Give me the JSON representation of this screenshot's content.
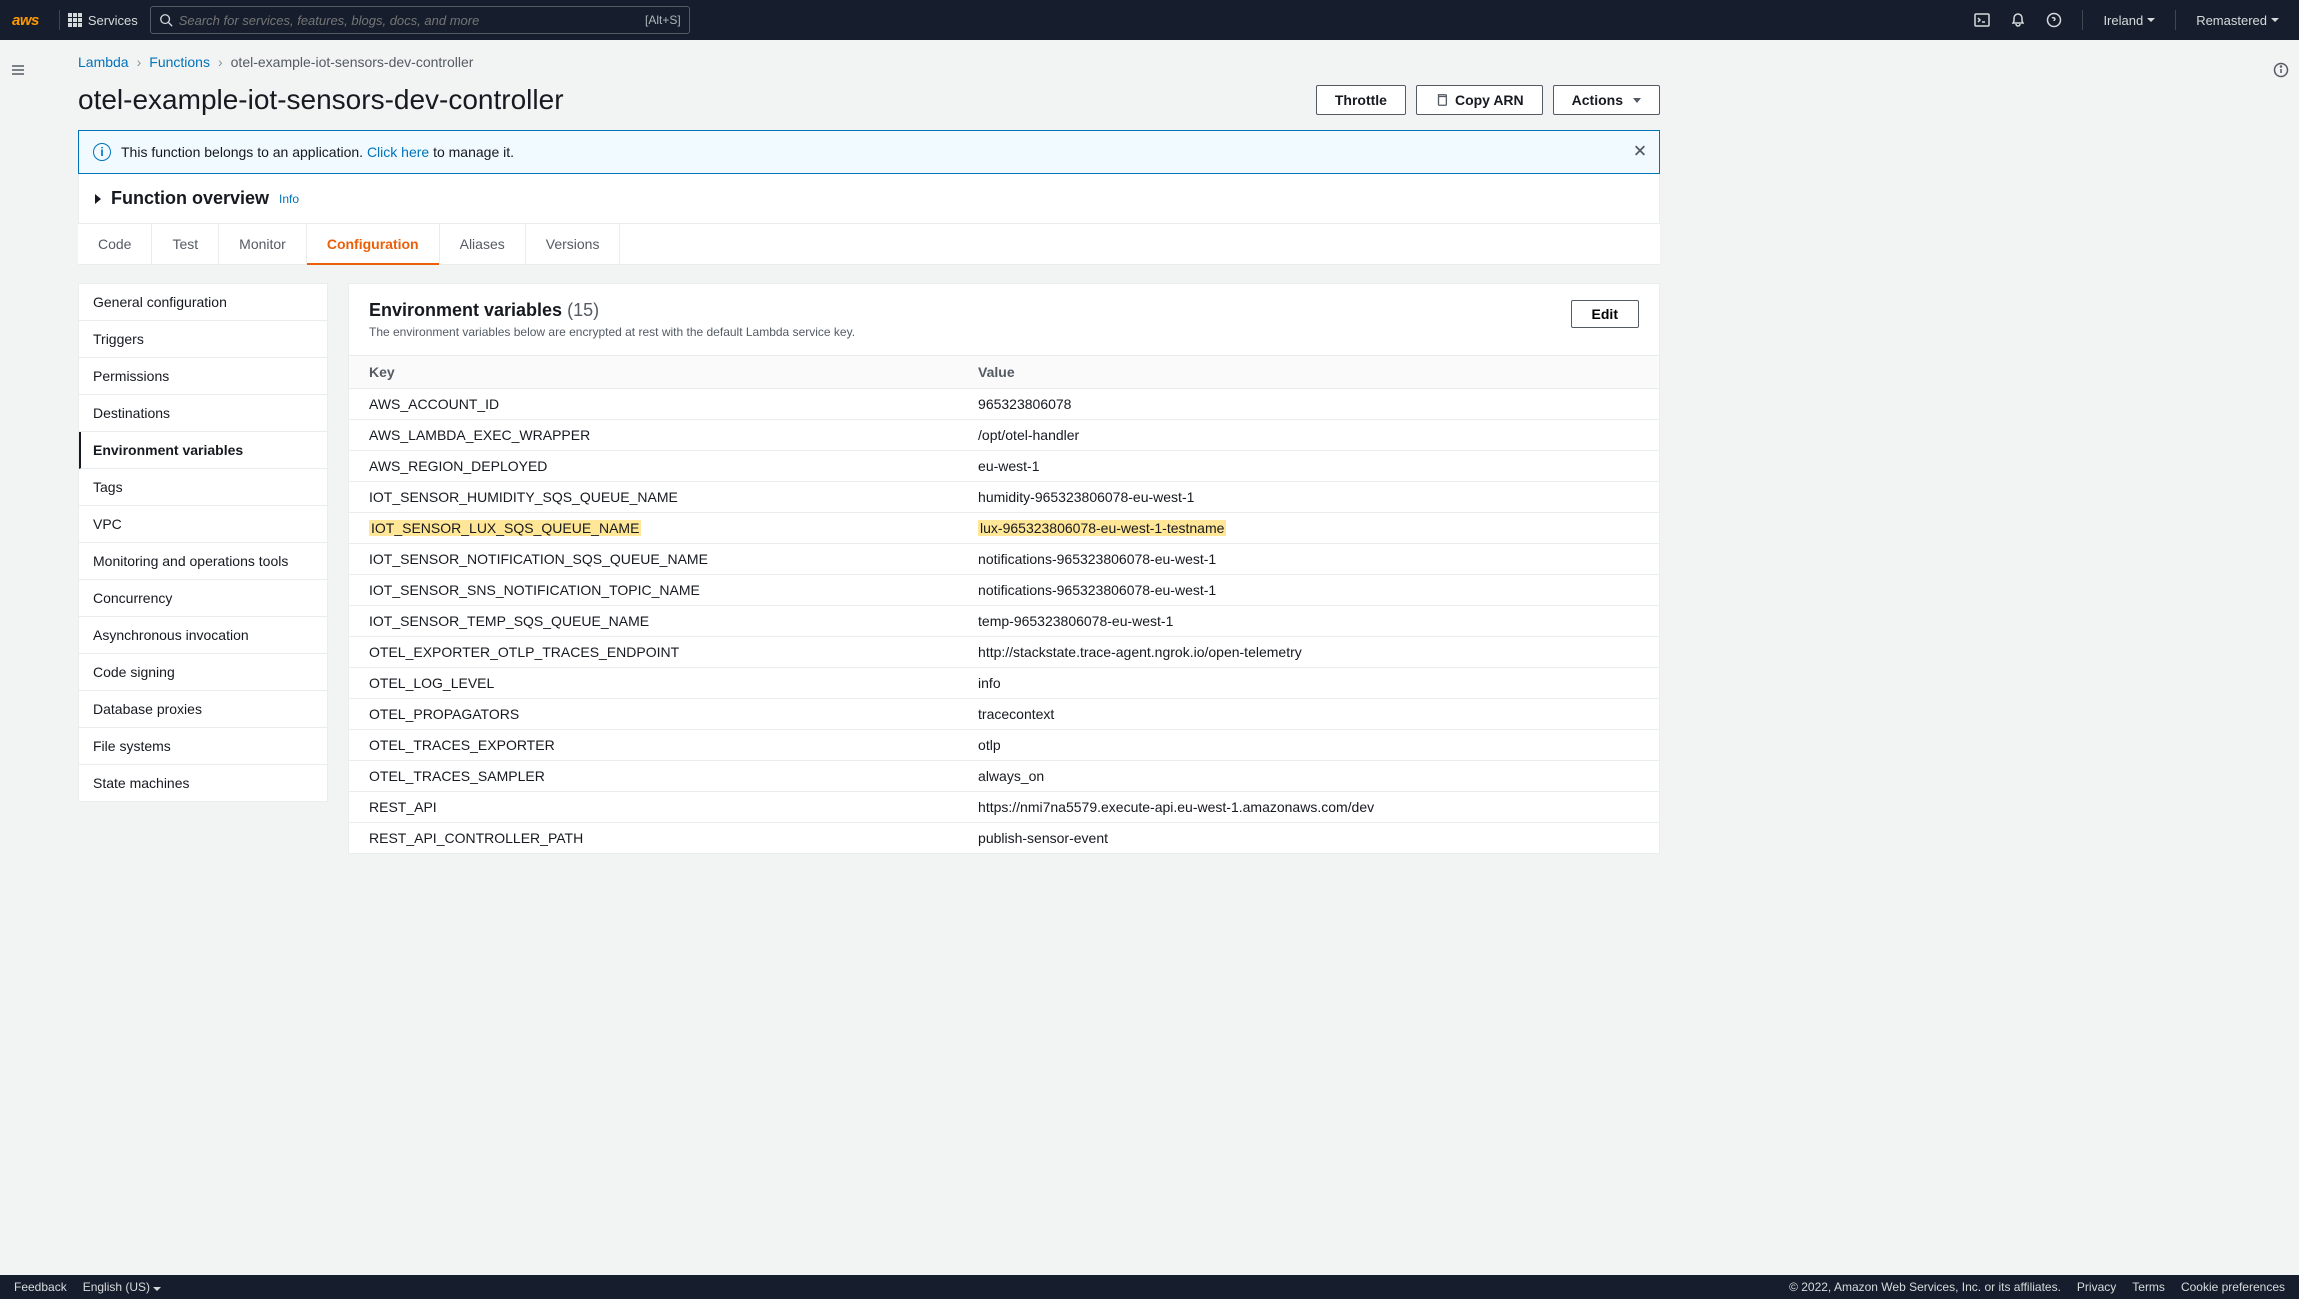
{
  "nav": {
    "logo": "aws",
    "services": "Services",
    "search_placeholder": "Search for services, features, blogs, docs, and more",
    "search_kbd": "[Alt+S]",
    "region": "Ireland",
    "account": "Remastered"
  },
  "breadcrumb": {
    "root": "Lambda",
    "functions": "Functions",
    "current": "otel-example-iot-sensors-dev-controller"
  },
  "page_title": "otel-example-iot-sensors-dev-controller",
  "buttons": {
    "throttle": "Throttle",
    "copy_arn": "Copy ARN",
    "actions": "Actions"
  },
  "banner": {
    "text_before": "This function belongs to an application. ",
    "link": "Click here",
    "text_after": " to manage it."
  },
  "overview": {
    "title": "Function overview",
    "info": "Info"
  },
  "tabs": [
    "Code",
    "Test",
    "Monitor",
    "Configuration",
    "Aliases",
    "Versions"
  ],
  "active_tab": "Configuration",
  "sidebar": [
    "General configuration",
    "Triggers",
    "Permissions",
    "Destinations",
    "Environment variables",
    "Tags",
    "VPC",
    "Monitoring and operations tools",
    "Concurrency",
    "Asynchronous invocation",
    "Code signing",
    "Database proxies",
    "File systems",
    "State machines"
  ],
  "active_sidebar": "Environment variables",
  "envvars": {
    "title": "Environment variables",
    "count": "(15)",
    "desc": "The environment variables below are encrypted at rest with the default Lambda service key.",
    "edit": "Edit",
    "columns": {
      "key": "Key",
      "value": "Value"
    },
    "rows": [
      {
        "k": "AWS_ACCOUNT_ID",
        "v": "965323806078"
      },
      {
        "k": "AWS_LAMBDA_EXEC_WRAPPER",
        "v": "/opt/otel-handler"
      },
      {
        "k": "AWS_REGION_DEPLOYED",
        "v": "eu-west-1"
      },
      {
        "k": "IOT_SENSOR_HUMIDITY_SQS_QUEUE_NAME",
        "v": "humidity-965323806078-eu-west-1"
      },
      {
        "k": "IOT_SENSOR_LUX_SQS_QUEUE_NAME",
        "v": "lux-965323806078-eu-west-1-testname",
        "highlight": true
      },
      {
        "k": "IOT_SENSOR_NOTIFICATION_SQS_QUEUE_NAME",
        "v": "notifications-965323806078-eu-west-1"
      },
      {
        "k": "IOT_SENSOR_SNS_NOTIFICATION_TOPIC_NAME",
        "v": "notifications-965323806078-eu-west-1"
      },
      {
        "k": "IOT_SENSOR_TEMP_SQS_QUEUE_NAME",
        "v": "temp-965323806078-eu-west-1"
      },
      {
        "k": "OTEL_EXPORTER_OTLP_TRACES_ENDPOINT",
        "v": "http://stackstate.trace-agent.ngrok.io/open-telemetry"
      },
      {
        "k": "OTEL_LOG_LEVEL",
        "v": "info"
      },
      {
        "k": "OTEL_PROPAGATORS",
        "v": "tracecontext"
      },
      {
        "k": "OTEL_TRACES_EXPORTER",
        "v": "otlp"
      },
      {
        "k": "OTEL_TRACES_SAMPLER",
        "v": "always_on"
      },
      {
        "k": "REST_API",
        "v": "https://nmi7na5579.execute-api.eu-west-1.amazonaws.com/dev"
      },
      {
        "k": "REST_API_CONTROLLER_PATH",
        "v": "publish-sensor-event"
      }
    ]
  },
  "footer": {
    "feedback": "Feedback",
    "language": "English (US)",
    "copyright": "© 2022, Amazon Web Services, Inc. or its affiliates.",
    "privacy": "Privacy",
    "terms": "Terms",
    "cookies": "Cookie preferences"
  }
}
